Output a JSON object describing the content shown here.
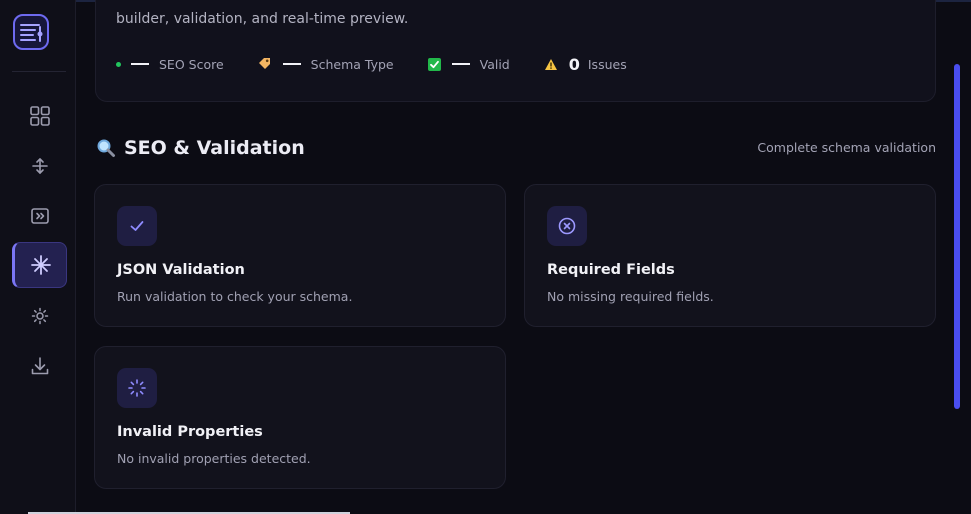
{
  "top_card": {
    "description": "builder, validation, and real-time preview.",
    "stats": {
      "seo_score_label": "SEO Score",
      "schema_type_label": "Schema Type",
      "valid_label": "Valid",
      "issues_count": "0",
      "issues_label": "Issues"
    }
  },
  "section": {
    "title": "SEO & Validation",
    "subtitle": "Complete schema validation"
  },
  "cards": [
    {
      "title": "JSON Validation",
      "text": "Run validation to check your schema.",
      "icon": "check-icon"
    },
    {
      "title": "Required Fields",
      "text": "No missing required fields.",
      "icon": "x-circle-icon"
    },
    {
      "title": "Invalid Properties",
      "text": "No invalid properties detected.",
      "icon": "loader-icon"
    }
  ],
  "sidebar": {
    "items": [
      {
        "icon": "grid-icon",
        "active": false
      },
      {
        "icon": "move-vertical-icon",
        "active": false
      },
      {
        "icon": "preview-icon",
        "active": false
      },
      {
        "icon": "sparkle-icon",
        "active": true
      },
      {
        "icon": "settings-icon",
        "active": false
      },
      {
        "icon": "download-icon",
        "active": false
      }
    ]
  },
  "colors": {
    "accent": "#7b76f4",
    "background": "#0c0c14",
    "card": "#12121c",
    "status_green": "#22c55e",
    "scrollbar": "#4a4ef0"
  }
}
